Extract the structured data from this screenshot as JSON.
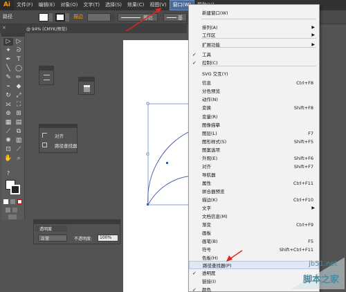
{
  "app": {
    "logo": "Ai"
  },
  "menubar": {
    "items": [
      "文件(F)",
      "编辑(E)",
      "对象(O)",
      "文字(T)",
      "选择(S)",
      "效果(C)",
      "视图(V)",
      "窗口(W)",
      "帮助(H)"
    ]
  },
  "controlbar": {
    "path_label": "路径",
    "stroke_label": "描边",
    "uniform_label_1": "等比",
    "uniform_label_2": "基本"
  },
  "document": {
    "tab_label": "@ 94% (CMYK/预览)"
  },
  "panels": {
    "align": {
      "item1": "对齐",
      "item2": "路径查找器"
    },
    "transparency": {
      "title": "透明度",
      "mode": "正常",
      "opacity_label": "不透明度:",
      "opacity_value": "100%"
    }
  },
  "window_menu": {
    "items": [
      {
        "label": "新建窗口(W)",
        "shortcut": "",
        "submenu": false,
        "checked": false
      },
      {
        "label": "排列(A)",
        "shortcut": "",
        "submenu": true,
        "checked": false
      },
      {
        "label": "工作区",
        "shortcut": "",
        "submenu": true,
        "checked": false
      },
      {
        "label": "扩展功能",
        "shortcut": "",
        "submenu": true,
        "checked": false
      },
      {
        "label": "工具",
        "shortcut": "",
        "submenu": false,
        "checked": true
      },
      {
        "label": "控制(C)",
        "shortcut": "",
        "submenu": false,
        "checked": true
      },
      {
        "label": "SVG 交互(Y)",
        "shortcut": "",
        "submenu": false,
        "checked": false
      },
      {
        "label": "信息",
        "shortcut": "Ctrl+F8",
        "submenu": false,
        "checked": false
      },
      {
        "label": "分色预览",
        "shortcut": "",
        "submenu": false,
        "checked": false
      },
      {
        "label": "动作(N)",
        "shortcut": "",
        "submenu": false,
        "checked": false
      },
      {
        "label": "变换",
        "shortcut": "Shift+F8",
        "submenu": false,
        "checked": false
      },
      {
        "label": "变量(R)",
        "shortcut": "",
        "submenu": false,
        "checked": false
      },
      {
        "label": "图像描摹",
        "shortcut": "",
        "submenu": false,
        "checked": false
      },
      {
        "label": "图层(L)",
        "shortcut": "F7",
        "submenu": false,
        "checked": false
      },
      {
        "label": "图形样式(S)",
        "shortcut": "Shift+F5",
        "submenu": false,
        "checked": false
      },
      {
        "label": "图案选项",
        "shortcut": "",
        "submenu": false,
        "checked": false
      },
      {
        "label": "外观(E)",
        "shortcut": "Shift+F6",
        "submenu": false,
        "checked": false
      },
      {
        "label": "对齐",
        "shortcut": "Shift+F7",
        "submenu": false,
        "checked": false
      },
      {
        "label": "导航器",
        "shortcut": "",
        "submenu": false,
        "checked": false
      },
      {
        "label": "属性",
        "shortcut": "Ctrl+F11",
        "submenu": false,
        "checked": false
      },
      {
        "label": "拼合器预览",
        "shortcut": "",
        "submenu": false,
        "checked": false
      },
      {
        "label": "描边(K)",
        "shortcut": "Ctrl+F10",
        "submenu": false,
        "checked": false
      },
      {
        "label": "文字",
        "shortcut": "",
        "submenu": true,
        "checked": false
      },
      {
        "label": "文档信息(M)",
        "shortcut": "",
        "submenu": false,
        "checked": false
      },
      {
        "label": "渐变",
        "shortcut": "Ctrl+F9",
        "submenu": false,
        "checked": false
      },
      {
        "label": "画板",
        "shortcut": "",
        "submenu": false,
        "checked": false
      },
      {
        "label": "画笔(B)",
        "shortcut": "F5",
        "submenu": false,
        "checked": false
      },
      {
        "label": "符号",
        "shortcut": "Shift+Ctrl+F11",
        "submenu": false,
        "checked": false
      },
      {
        "label": "色板(H)",
        "shortcut": "",
        "submenu": false,
        "checked": false
      },
      {
        "label": "路径查找器(P)",
        "shortcut": "",
        "submenu": false,
        "checked": false,
        "highlighted": true
      },
      {
        "label": "透明度",
        "shortcut": "",
        "submenu": false,
        "checked": true
      },
      {
        "label": "链接(I)",
        "shortcut": "",
        "submenu": false,
        "checked": false
      },
      {
        "label": "颜色",
        "shortcut": "",
        "submenu": false,
        "checked": true
      }
    ]
  },
  "watermark": {
    "line1": "jb51.net",
    "line2": "脚本之家"
  },
  "colors": {
    "menu_highlight": "#dfe8f4",
    "annotation_arrow": "#e0231b",
    "brand_orange": "#ff9a00"
  }
}
